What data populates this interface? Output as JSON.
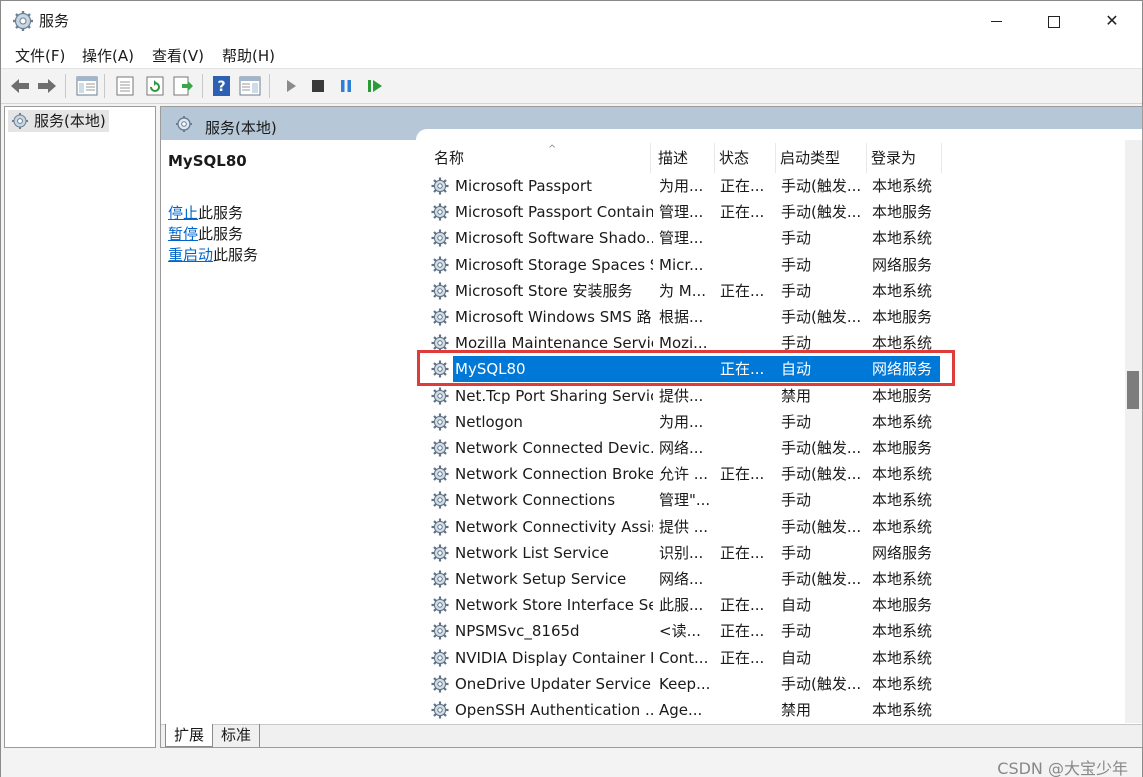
{
  "window": {
    "title": "服务",
    "minimize_label": "minimize",
    "maximize_label": "maximize",
    "close_label": "close"
  },
  "menu": [
    "文件(F)",
    "操作(A)",
    "查看(V)",
    "帮助(H)"
  ],
  "tree": {
    "root_label": "服务(本地)"
  },
  "pane": {
    "title": "服务(本地)",
    "selected_service": "MySQL80",
    "actions": [
      {
        "link": "停止",
        "suffix": "此服务"
      },
      {
        "link": "暂停",
        "suffix": "此服务"
      },
      {
        "link": "重启动",
        "suffix": "此服务"
      }
    ]
  },
  "columns": [
    "名称",
    "描述",
    "状态",
    "启动类型",
    "登录为"
  ],
  "services": [
    {
      "name": "Microsoft Passport",
      "desc": "为用...",
      "status": "正在...",
      "startup": "手动(触发...",
      "logon": "本地系统"
    },
    {
      "name": "Microsoft Passport Container",
      "desc": "管理...",
      "status": "正在...",
      "startup": "手动(触发...",
      "logon": "本地服务"
    },
    {
      "name": "Microsoft Software Shado...",
      "desc": "管理...",
      "status": "",
      "startup": "手动",
      "logon": "本地系统"
    },
    {
      "name": "Microsoft Storage Spaces S...",
      "desc": "Micr...",
      "status": "",
      "startup": "手动",
      "logon": "网络服务"
    },
    {
      "name": "Microsoft Store 安装服务",
      "desc": "为 M...",
      "status": "正在...",
      "startup": "手动",
      "logon": "本地系统"
    },
    {
      "name": "Microsoft Windows SMS 路...",
      "desc": "根据...",
      "status": "",
      "startup": "手动(触发...",
      "logon": "本地服务"
    },
    {
      "name": "Mozilla Maintenance Service",
      "desc": "Mozi...",
      "status": "",
      "startup": "手动",
      "logon": "本地系统"
    },
    {
      "name": "MySQL80",
      "desc": "",
      "status": "正在...",
      "startup": "自动",
      "logon": "网络服务",
      "selected": true
    },
    {
      "name": "Net.Tcp Port Sharing Service",
      "desc": "提供...",
      "status": "",
      "startup": "禁用",
      "logon": "本地服务"
    },
    {
      "name": "Netlogon",
      "desc": "为用...",
      "status": "",
      "startup": "手动",
      "logon": "本地系统"
    },
    {
      "name": "Network Connected Devic...",
      "desc": "网络...",
      "status": "",
      "startup": "手动(触发...",
      "logon": "本地服务"
    },
    {
      "name": "Network Connection Broker",
      "desc": "允许 ...",
      "status": "正在...",
      "startup": "手动(触发...",
      "logon": "本地系统"
    },
    {
      "name": "Network Connections",
      "desc": "管理\"...",
      "status": "",
      "startup": "手动",
      "logon": "本地系统"
    },
    {
      "name": "Network Connectivity Assis...",
      "desc": "提供 ...",
      "status": "",
      "startup": "手动(触发...",
      "logon": "本地系统"
    },
    {
      "name": "Network List Service",
      "desc": "识别...",
      "status": "正在...",
      "startup": "手动",
      "logon": "网络服务"
    },
    {
      "name": "Network Setup Service",
      "desc": "网络...",
      "status": "",
      "startup": "手动(触发...",
      "logon": "本地系统"
    },
    {
      "name": "Network Store Interface Se...",
      "desc": "此服...",
      "status": "正在...",
      "startup": "自动",
      "logon": "本地服务"
    },
    {
      "name": "NPSMSvc_8165d",
      "desc": "<读...",
      "status": "正在...",
      "startup": "手动",
      "logon": "本地系统"
    },
    {
      "name": "NVIDIA Display Container LS",
      "desc": "Cont...",
      "status": "正在...",
      "startup": "自动",
      "logon": "本地系统"
    },
    {
      "name": "OneDrive Updater Service",
      "desc": "Keep...",
      "status": "",
      "startup": "手动(触发...",
      "logon": "本地系统"
    },
    {
      "name": "OpenSSH Authentication ...",
      "desc": "Age...",
      "status": "",
      "startup": "禁用",
      "logon": "本地系统"
    }
  ],
  "tabs": [
    "扩展",
    "标准"
  ],
  "watermark": "CSDN @大宝少年",
  "colors": {
    "selection": "#0078d7",
    "highlight_box": "#e03b3b",
    "header_band": "#b6c8d8",
    "link": "#0066cc"
  }
}
